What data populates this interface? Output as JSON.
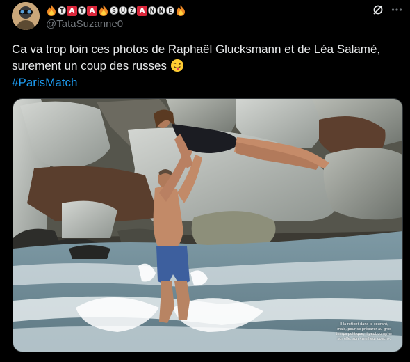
{
  "author": {
    "display_name_tiles": [
      "T",
      "A",
      "T",
      "A",
      "S",
      "U",
      "Z",
      "A",
      "N",
      "N",
      "E"
    ],
    "handle": "@TataSuzanne0",
    "avatar_icon": "avatar-photo"
  },
  "tweet": {
    "line1": "Ca va trop loin ces photos de Raphaël Glucksmann et de Léa Salamé,",
    "line2": "surement un coup des russes",
    "emoji": "winking-face-with-tongue",
    "hashtag": "#ParisMatch"
  },
  "actions": {
    "grok_icon": "grok-icon",
    "more_icon": "more-icon"
  },
  "media": {
    "caption": "Il la retient dans le courant, mais, pour se préparer au gros temps politique, il peut compter sur elle, son «meilleur coach»."
  },
  "colors": {
    "background": "#000000",
    "text": "#e7e9ea",
    "secondary": "#71767b",
    "link": "#1d9bf0",
    "tile_red": "#d9263a"
  }
}
